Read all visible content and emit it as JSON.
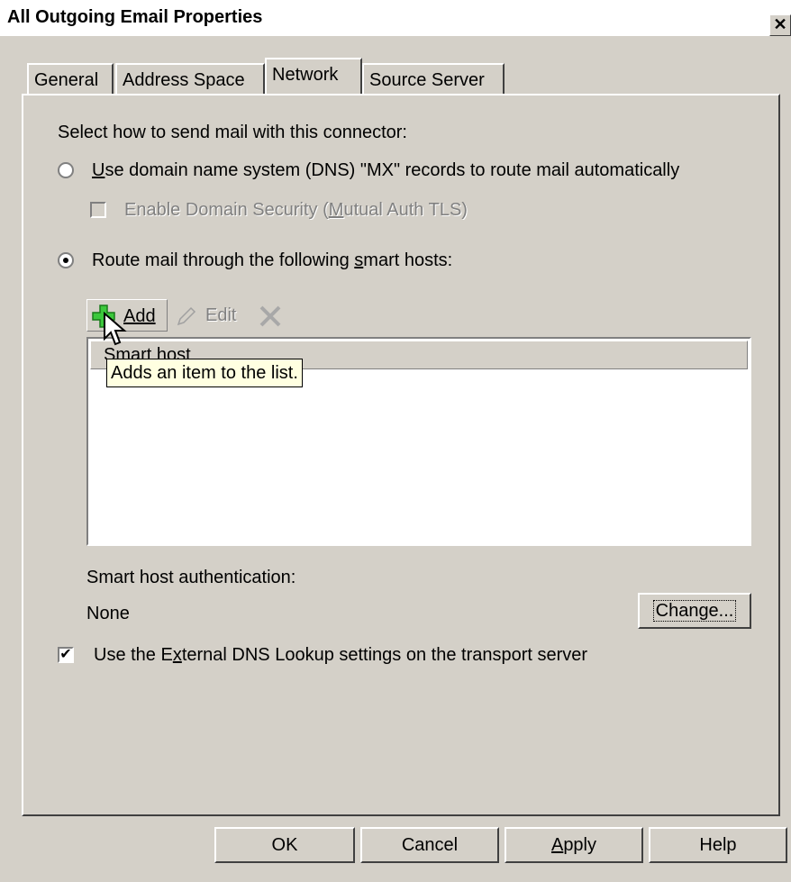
{
  "window": {
    "title": "All Outgoing Email Properties",
    "close_label": "x"
  },
  "tabs": [
    {
      "label": "General"
    },
    {
      "label": "Address Space"
    },
    {
      "label": "Network"
    },
    {
      "label": "Source Server"
    }
  ],
  "network": {
    "section_label": "Select how to send mail with this connector:",
    "dns_option": {
      "label_pre": "",
      "label_u": "U",
      "label_post": "se domain name system (DNS) \"MX\" records to route mail automatically",
      "selected": false
    },
    "domain_security": {
      "label_pre": "Enable Domain Security (",
      "label_u": "M",
      "label_post": "utual Auth TLS)",
      "checked": false,
      "enabled": false
    },
    "smart_host_option": {
      "label_pre": "Route mail through the following ",
      "label_u": "s",
      "label_post": "mart hosts:",
      "selected": true
    },
    "toolbar": {
      "add_label": "Add",
      "edit_label": "Edit"
    },
    "list": {
      "column_header": "Smart host"
    },
    "tooltip": "Adds an item to the list.",
    "auth": {
      "label": "Smart host authentication:",
      "value": "None",
      "change_label": "Change..."
    },
    "external_dns": {
      "label_pre": "Use the E",
      "label_u": "x",
      "label_post": "ternal DNS Lookup settings on the transport server",
      "checked": true
    }
  },
  "buttons": {
    "ok": "OK",
    "cancel": "Cancel",
    "apply_u": "A",
    "apply_rest": "pply",
    "help": "Help"
  }
}
